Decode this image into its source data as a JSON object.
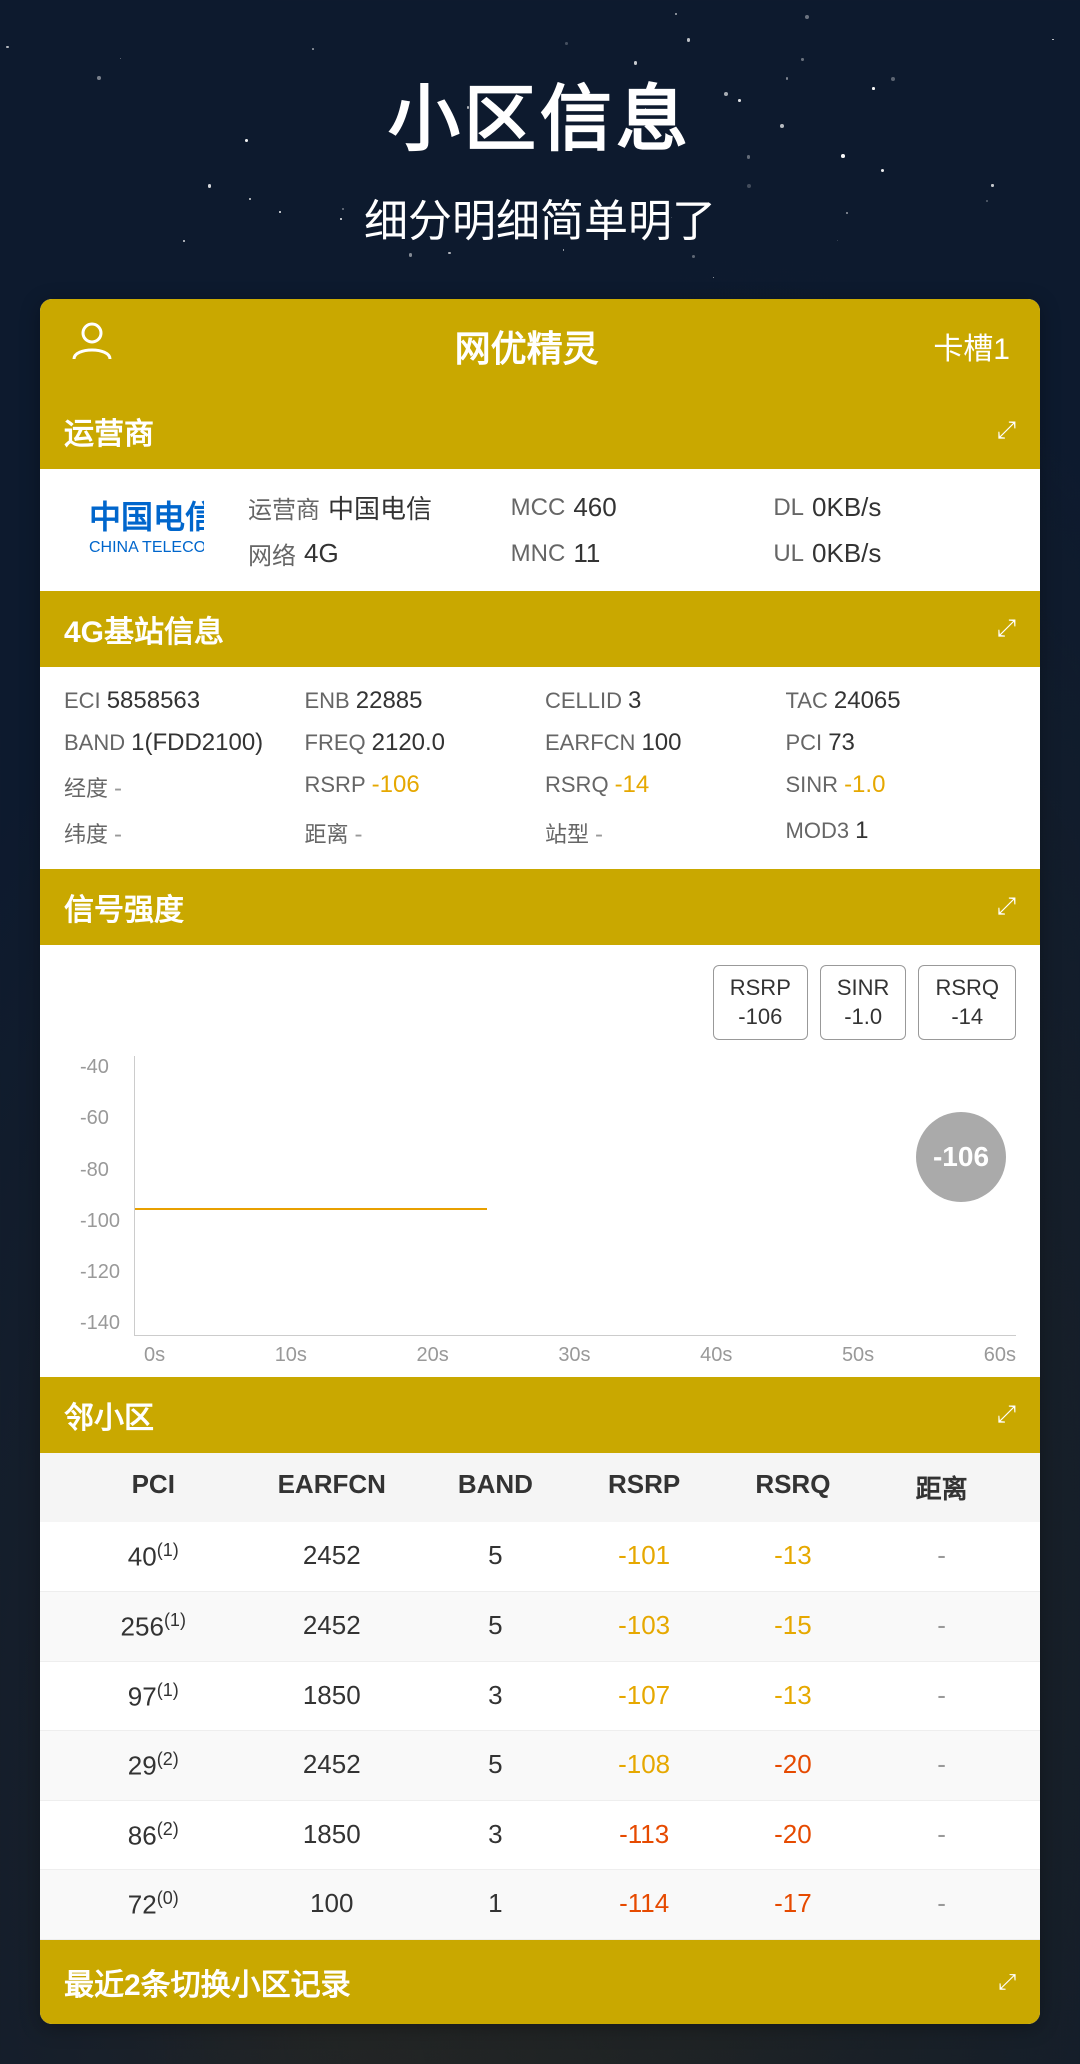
{
  "page": {
    "title": "小区信息",
    "subtitle": "细分明细简单明了"
  },
  "app_header": {
    "app_name": "网优精灵",
    "slot": "卡槽1"
  },
  "operator_section": {
    "title": "运营商",
    "operator_label": "运营商",
    "operator_value": "中国电信",
    "network_label": "网络",
    "network_value": "4G",
    "mcc_label": "MCC",
    "mcc_value": "460",
    "mnc_label": "MNC",
    "mnc_value": "11",
    "dl_label": "DL",
    "dl_value": "0KB/s",
    "ul_label": "UL",
    "ul_value": "0KB/s"
  },
  "station_section": {
    "title": "4G基站信息",
    "fields": [
      {
        "label": "ECI",
        "value": "5858563",
        "color": "normal"
      },
      {
        "label": "ENB",
        "value": "22885",
        "color": "normal"
      },
      {
        "label": "CELLID",
        "value": "3",
        "color": "normal"
      },
      {
        "label": "TAC",
        "value": "24065",
        "color": "normal"
      },
      {
        "label": "BAND",
        "value": "1(FDD2100)",
        "color": "normal"
      },
      {
        "label": "FREQ",
        "value": "2120.0",
        "color": "normal"
      },
      {
        "label": "EARFCN",
        "value": "100",
        "color": "normal"
      },
      {
        "label": "PCI",
        "value": "73",
        "color": "normal"
      },
      {
        "label": "经度",
        "value": "-",
        "color": "dash"
      },
      {
        "label": "RSRP",
        "value": "-106",
        "color": "yellow"
      },
      {
        "label": "RSRQ",
        "value": "-14",
        "color": "yellow"
      },
      {
        "label": "SINR",
        "value": "-1.0",
        "color": "yellow"
      },
      {
        "label": "纬度",
        "value": "-",
        "color": "dash"
      },
      {
        "label": "距离",
        "value": "-",
        "color": "dash"
      },
      {
        "label": "站型",
        "value": "-",
        "color": "dash"
      },
      {
        "label": "MOD3",
        "value": "1",
        "color": "normal"
      }
    ]
  },
  "signal_section": {
    "title": "信号强度",
    "badges": [
      {
        "label": "RSRP",
        "value": "-106"
      },
      {
        "label": "SINR",
        "value": "-1.0"
      },
      {
        "label": "RSRQ",
        "value": "-14"
      }
    ],
    "bubble_value": "-106",
    "y_labels": [
      "-40",
      "-60",
      "-80",
      "-100",
      "-120",
      "-140"
    ],
    "x_labels": [
      "0s",
      "10s",
      "20s",
      "30s",
      "40s",
      "50s",
      "60s"
    ]
  },
  "neighbor_section": {
    "title": "邻小区",
    "columns": [
      "PCI",
      "EARFCN",
      "BAND",
      "RSRP",
      "RSRQ",
      "距离"
    ],
    "rows": [
      {
        "pci": "40",
        "sup": "(1)",
        "earfcn": "2452",
        "band": "5",
        "rsrp": "-101",
        "rsrp_color": "yellow",
        "rsrq": "-13",
        "rsrq_color": "yellow",
        "dist": "-"
      },
      {
        "pci": "256",
        "sup": "(1)",
        "earfcn": "2452",
        "band": "5",
        "rsrp": "-103",
        "rsrp_color": "yellow",
        "rsrq": "-15",
        "rsrq_color": "yellow",
        "dist": "-"
      },
      {
        "pci": "97",
        "sup": "(1)",
        "earfcn": "1850",
        "band": "3",
        "rsrp": "-107",
        "rsrp_color": "yellow",
        "rsrq": "-13",
        "rsrq_color": "yellow",
        "dist": "-"
      },
      {
        "pci": "29",
        "sup": "(2)",
        "earfcn": "2452",
        "band": "5",
        "rsrp": "-108",
        "rsrp_color": "yellow",
        "rsrq": "-20",
        "rsrq_color": "red",
        "dist": "-"
      },
      {
        "pci": "86",
        "sup": "(2)",
        "earfcn": "1850",
        "band": "3",
        "rsrp": "-113",
        "rsrp_color": "red",
        "rsrq": "-20",
        "rsrq_color": "red",
        "dist": "-"
      },
      {
        "pci": "72",
        "sup": "(0)",
        "earfcn": "100",
        "band": "1",
        "rsrp": "-114",
        "rsrp_color": "red",
        "rsrq": "-17",
        "rsrq_color": "red",
        "dist": "-"
      }
    ]
  },
  "bottom_section": {
    "title": "最近2条切换小区记录"
  }
}
